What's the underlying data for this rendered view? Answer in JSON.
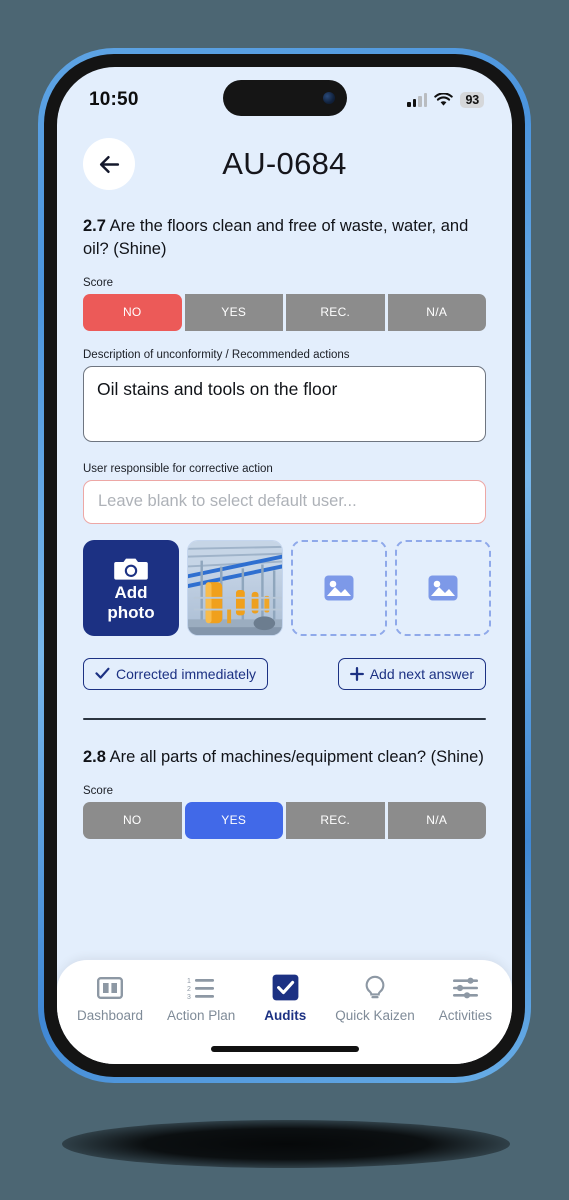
{
  "status_bar": {
    "time": "10:50",
    "battery": "93",
    "signal_icon": "cellular-signal-icon",
    "wifi_icon": "wifi-icon",
    "signal_bars_filled": 2,
    "signal_bars_total": 4
  },
  "header": {
    "back_icon": "arrow-left-icon",
    "title": "AU-0684"
  },
  "questions": [
    {
      "number": "2.7",
      "text": "Are the floors clean and free of waste, water, and oil? (Shine)",
      "score_label": "Score",
      "score_options": [
        "NO",
        "YES",
        "REC.",
        "N/A"
      ],
      "selected_score": "NO",
      "description_label": "Description of unconformity / Recommended actions",
      "description_value": "Oil stains and tools on the floor",
      "description_placeholder": "",
      "user_label": "User responsible for corrective action",
      "user_value": "",
      "user_placeholder": "Leave blank to select default user...",
      "add_photo_label_line1": "Add",
      "add_photo_label_line2": "photo",
      "add_photo_icon": "camera-icon",
      "photo_thumbnail_alt": "industrial-plant-photo",
      "empty_photo_icon": "image-placeholder-icon",
      "empty_photo_slots": 2,
      "corrected_button": "Corrected immediately",
      "corrected_icon": "check-icon",
      "add_answer_button": "Add next answer",
      "add_answer_icon": "plus-icon"
    },
    {
      "number": "2.8",
      "text": "Are all parts of machines/equipment clean? (Shine)",
      "score_label": "Score",
      "score_options": [
        "NO",
        "YES",
        "REC.",
        "N/A"
      ],
      "selected_score": "YES"
    }
  ],
  "bottom_nav": [
    {
      "label": "Dashboard",
      "icon": "dashboard-layout-icon",
      "active": false
    },
    {
      "label": "Action Plan",
      "icon": "numbered-list-icon",
      "active": false
    },
    {
      "label": "Audits",
      "icon": "checkbox-check-icon",
      "active": true
    },
    {
      "label": "Quick Kaizen",
      "icon": "lightbulb-icon",
      "active": false
    },
    {
      "label": "Activities",
      "icon": "sliders-icon",
      "active": false
    }
  ],
  "colors": {
    "page_background": "#4c6673",
    "screen_background": "#e3eefc",
    "brand_navy": "#1c3183",
    "score_no_red": "#ec5a58",
    "score_yes_blue": "#4169e8",
    "score_inactive_gray": "#8c8c8c",
    "user_field_border": "#eda7a5",
    "dashed_placeholder": "#8fa9ea"
  }
}
